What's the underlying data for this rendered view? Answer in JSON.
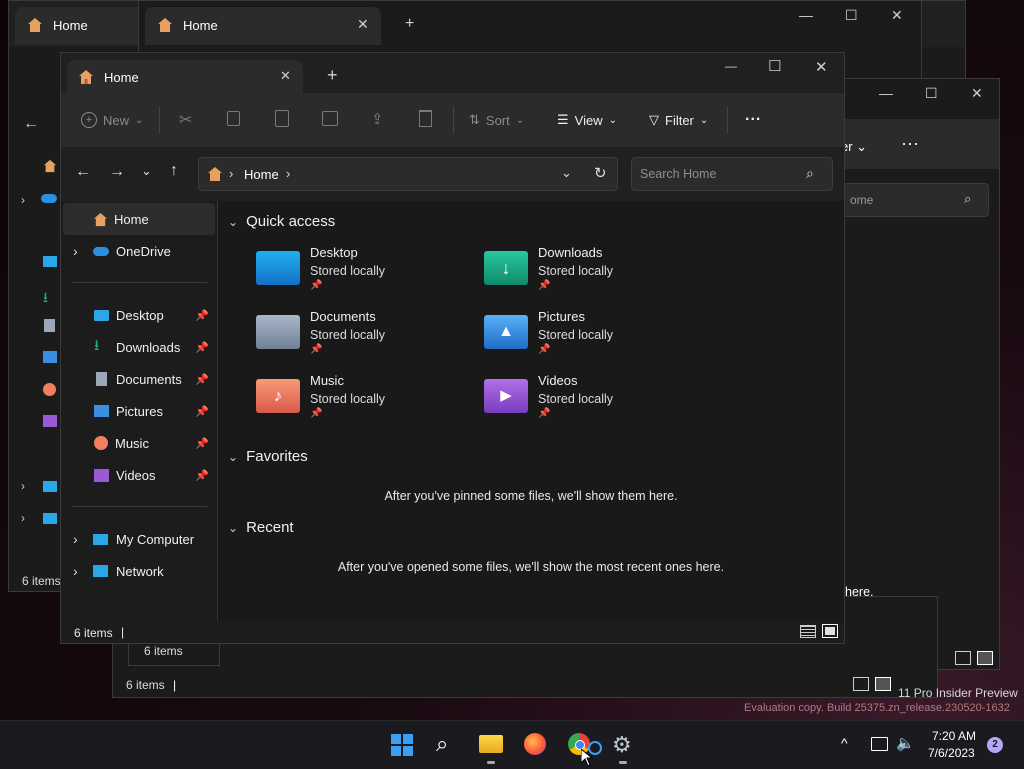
{
  "back_windows": {
    "tab_title": "Home",
    "status_items": "6 items",
    "back_sidebar_sizes_hint": "",
    "right_filter_label": "er",
    "right_search_text": "ome",
    "right_status_text": "here."
  },
  "window": {
    "tab_title": "Home",
    "new_tab": "+",
    "minimize": "—",
    "maximize": "☐",
    "close": "✕"
  },
  "toolbar": {
    "new_label": "New",
    "sort_label": "Sort",
    "view_label": "View",
    "filter_label": "Filter",
    "more_label": "..."
  },
  "address": {
    "path": "Home",
    "search_placeholder": "Search Home"
  },
  "sidebar": {
    "home": "Home",
    "onedrive": "OneDrive",
    "pinned": [
      "Desktop",
      "Downloads",
      "Documents",
      "Pictures",
      "Music",
      "Videos"
    ],
    "my_computer": "My Computer",
    "network": "Network"
  },
  "main": {
    "quick_access_title": "Quick access",
    "quick_access": [
      {
        "name": "Desktop",
        "sub": "Stored locally",
        "icon": "desktop-folder-icon"
      },
      {
        "name": "Downloads",
        "sub": "Stored locally",
        "icon": "downloads-folder-icon"
      },
      {
        "name": "Documents",
        "sub": "Stored locally",
        "icon": "documents-folder-icon"
      },
      {
        "name": "Pictures",
        "sub": "Stored locally",
        "icon": "pictures-folder-icon"
      },
      {
        "name": "Music",
        "sub": "Stored locally",
        "icon": "music-folder-icon"
      },
      {
        "name": "Videos",
        "sub": "Stored locally",
        "icon": "videos-folder-icon"
      }
    ],
    "favorites_title": "Favorites",
    "favorites_empty": "After you've pinned some files, we'll show them here.",
    "recent_title": "Recent",
    "recent_empty": "After you've opened some files, we'll show the most recent ones here."
  },
  "status": {
    "items": "6 items",
    "sep": "|"
  },
  "watermark": {
    "line1": "11 Pro Insider Preview",
    "line2": "Evaluation copy. Build 25375.zn_release.230520-1632"
  },
  "taskbar": {
    "time": "7:20 AM",
    "date": "7/6/2023",
    "notification_count": "2"
  },
  "colors": {
    "accent": "#0078d4",
    "folder_desktop": "#2aa7e6",
    "folder_downloads": "#19b38a",
    "folder_documents": "#8fa3b8",
    "folder_pictures": "#3a8fe0",
    "folder_music": "#f08060",
    "folder_videos": "#9a5ad8"
  }
}
